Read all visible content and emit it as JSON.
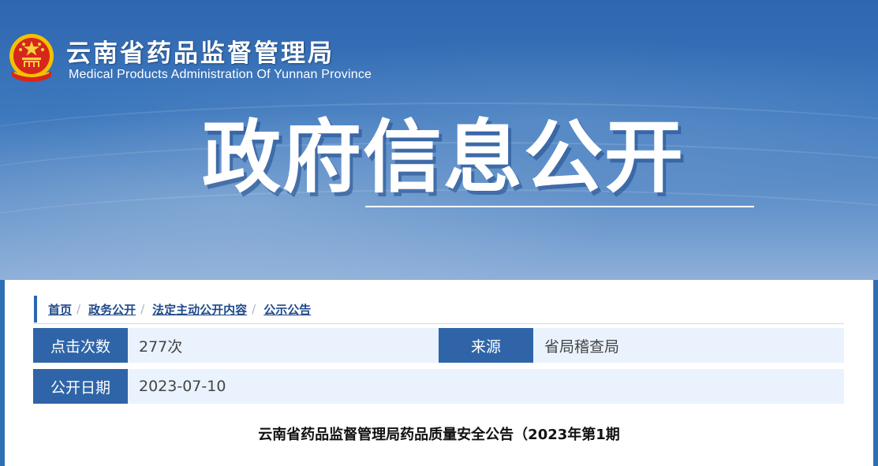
{
  "header": {
    "title_cn": "云南省药品监督管理局",
    "title_en": "Medical Products Administration Of Yunnan Province",
    "emblem_icon": "national-emblem-icon"
  },
  "banner": {
    "title": "政府信息公开"
  },
  "breadcrumb": [
    {
      "label": "首页"
    },
    {
      "label": "政务公开"
    },
    {
      "label": "法定主动公开内容"
    },
    {
      "label": "公示公告"
    }
  ],
  "info": {
    "clicks_label": "点击次数",
    "clicks_value": "277次",
    "source_label": "来源",
    "source_value": "省局稽查局",
    "date_label": "公开日期",
    "date_value": "2023-07-10"
  },
  "article": {
    "title": "云南省药品监督管理局药品质量安全公告（2023年第1期"
  },
  "colors": {
    "label_bg": "#2f65a8",
    "value_bg": "#eaf3fd",
    "link": "#1f4a8a"
  }
}
